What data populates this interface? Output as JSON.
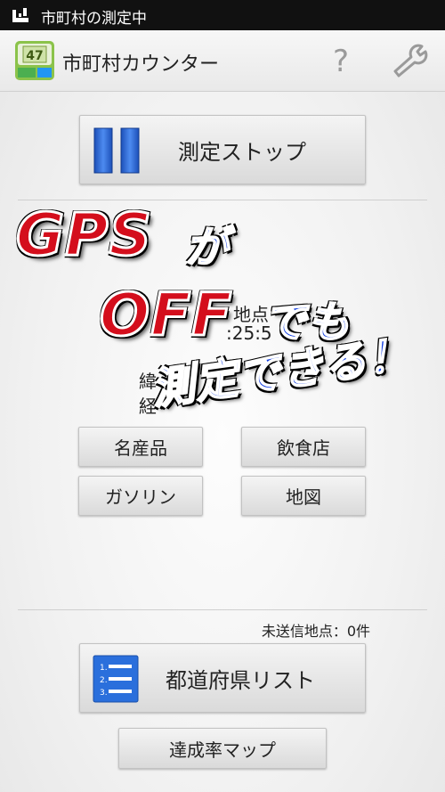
{
  "status_bar": {
    "icon": "usb-icon",
    "text": "市町村の測定中"
  },
  "action_bar": {
    "title": "市町村カウンター",
    "app_icon": "app-logo-icon",
    "help_icon": "question-mark-icon",
    "settings_icon": "wrench-icon"
  },
  "main": {
    "stop_button": {
      "label": "測定ストップ",
      "icon": "pause-icon"
    },
    "partial_info": {
      "line1": "地点",
      "line2": ":25:5",
      "line3": "緯",
      "line4": "経"
    },
    "grid_buttons": [
      "名産品",
      "飲食店",
      "ガソリン",
      "地図"
    ],
    "pending_count": "未送信地点：0件",
    "prefecture_list_button": {
      "label": "都道府県リスト",
      "icon": "list-icon"
    },
    "achievement_map_button": {
      "label": "達成率マップ"
    }
  },
  "promo_overlay": {
    "line1_red": "GPS",
    "line1_blue": "が",
    "line2_red": "OFF",
    "line2_blue": "でも",
    "line3_blue": "測定できる！"
  },
  "colors": {
    "status_bar": "#111111",
    "overlay_red": "#d40e1c",
    "overlay_blue": "#1742e0",
    "icon_blue": "#2a6fdc"
  }
}
